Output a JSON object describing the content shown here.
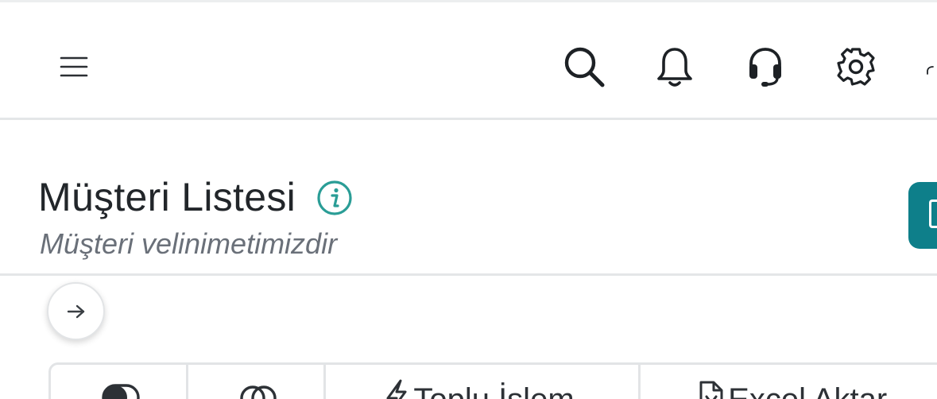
{
  "header": {
    "title": "Müşteri Listesi",
    "subtitle": "Müşteri velinimetimizdir"
  },
  "topbar": {
    "icons": [
      "menu-icon",
      "search-icon",
      "bell-icon",
      "headset-icon",
      "gear-icon",
      "user-icon"
    ]
  },
  "toolbar": {
    "bulk_label": "Toplu İşlem",
    "excel_label": "Excel Aktar"
  },
  "colors": {
    "accent": "#0e7f8a",
    "info": "#2a9d96",
    "border": "#e4e6e8",
    "subtitle": "#6a7079"
  }
}
